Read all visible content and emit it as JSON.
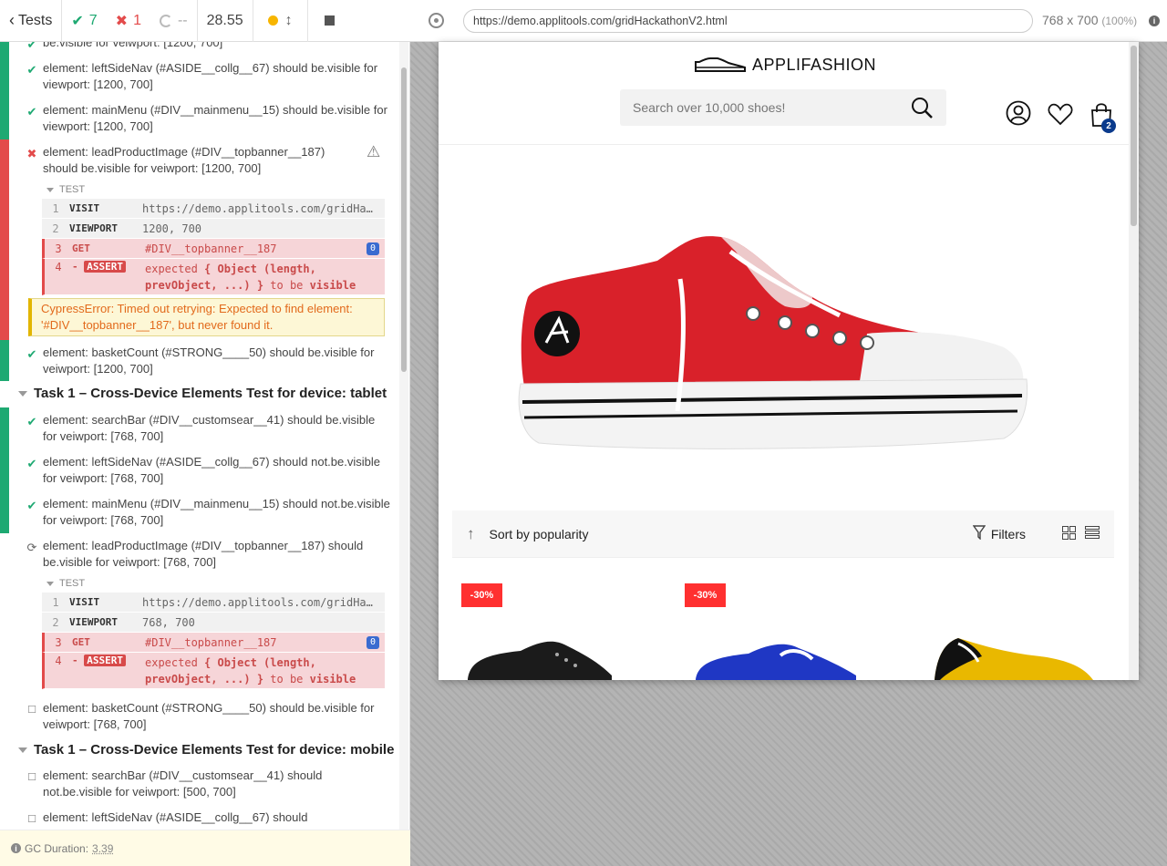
{
  "topbar": {
    "tests_label": "Tests",
    "passed": "7",
    "failed": "1",
    "pending": "--",
    "duration": "28.55"
  },
  "aut": {
    "url": "https://demo.applitools.com/gridHackathonV2.html",
    "viewport": "768 x 700",
    "scale": "(100%)"
  },
  "reporter": {
    "tests_a": [
      {
        "text": "be.visible for veiwport: [1200, 700]",
        "state": "passed"
      },
      {
        "text": "element: leftSideNav (#ASIDE__collg__67) should be.visible for viewport: [1200, 700]",
        "state": "passed"
      },
      {
        "text": "element: mainMenu (#DIV__mainmenu__15) should be.visible for viewport: [1200, 700]",
        "state": "passed"
      },
      {
        "text": "element: leadProductImage (#DIV__topbanner__187) should be.visible for veiwport: [1200, 700]",
        "state": "failed"
      }
    ],
    "log1": {
      "header": "TEST",
      "rows": [
        {
          "num": "1",
          "name": "VISIT",
          "msg": "https://demo.applitools.com/gridHackathonV2.html"
        },
        {
          "num": "2",
          "name": "VIEWPORT",
          "msg": "1200, 700"
        },
        {
          "num": "3",
          "name": "GET",
          "msg": "#DIV__topbanner__187",
          "badge": "0"
        },
        {
          "num": "4",
          "name": "ASSERT",
          "msg_a": "expected",
          "msg_b": "{ Object (length, prevObject, ...) }",
          "msg_c": "to be",
          "msg_d": "visible"
        }
      ]
    },
    "error": "CypressError: Timed out retrying: Expected to find element: '#DIV__topbanner__187', but never found it.",
    "test_basket_1": "element: basketCount (#STRONG____50) should be.visible for veiwport: [1200, 700]",
    "suite_tablet": "Task 1 – Cross-Device Elements Test for device: tablet",
    "tests_tablet": [
      {
        "text": "element: searchBar (#DIV__customsear__41) should be.visible for veiwport: [768, 700]"
      },
      {
        "text": "element: leftSideNav (#ASIDE__collg__67) should not.be.visible for veiwport: [768, 700]"
      },
      {
        "text": "element: mainMenu (#DIV__mainmenu__15) should not.be.visible for veiwport: [768, 700]"
      },
      {
        "text": "element: leadProductImage (#DIV__topbanner__187) should be.visible for veiwport: [768, 700]"
      }
    ],
    "log2": {
      "header": "TEST",
      "rows": [
        {
          "num": "1",
          "name": "VISIT",
          "msg": "https://demo.applitools.com/gridHackathonV2.html"
        },
        {
          "num": "2",
          "name": "VIEWPORT",
          "msg": "768, 700"
        },
        {
          "num": "3",
          "name": "GET",
          "msg": "#DIV__topbanner__187",
          "badge": "0"
        },
        {
          "num": "4",
          "name": "ASSERT",
          "msg_a": "expected",
          "msg_b": "{ Object (length, prevObject, ...) }",
          "msg_c": "to be",
          "msg_d": "visible"
        }
      ]
    },
    "test_basket_2": "element: basketCount (#STRONG____50) should be.visible for veiwport: [768, 700]",
    "suite_mobile": "Task 1 – Cross-Device Elements Test for device: mobile",
    "tests_mobile": [
      {
        "text": "element: searchBar (#DIV__customsear__41) should not.be.visible for veiwport: [500, 700]"
      },
      {
        "text": "element: leftSideNav (#ASIDE__collg__67) should"
      }
    ]
  },
  "footer": {
    "label": "GC Duration:",
    "value": "3.39"
  },
  "shop": {
    "brand": "APPLIFASHION",
    "search_placeholder": "Search over 10,000 shoes!",
    "cart_count": "2",
    "sort_label": "Sort by popularity",
    "filters_label": "Filters",
    "discount_1": "-30%",
    "discount_2": "-30%"
  },
  "colors": {
    "pass": "#1ea972",
    "fail": "#e34b4b",
    "pending": "#aaaaaa"
  }
}
